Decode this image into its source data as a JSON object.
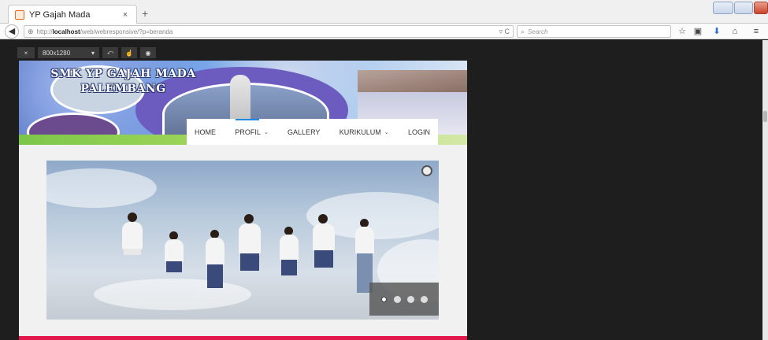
{
  "browser": {
    "tab_title": "YP Gajah Mada",
    "tab_close": "×",
    "new_tab": "+",
    "url_prefix": "http://",
    "url_host": "localhost",
    "url_path": "/web/webresponsive/?p=beranda",
    "search_placeholder": "Search",
    "icons": [
      "back-arrow-icon",
      "globe-icon",
      "reload-icon",
      "search-icon",
      "bookmark-star-icon",
      "clipboard-icon",
      "download-icon",
      "home-icon",
      "menu-icon"
    ]
  },
  "rdm": {
    "close_label": "×",
    "size_label": "800x1280",
    "size_caret": "▾"
  },
  "site": {
    "school_name_line1": "SMK YP GAJAH MADA",
    "school_name_line2": "PALEMBANG",
    "nav": [
      {
        "label": "HOME",
        "has_dropdown": false
      },
      {
        "label": "PROFIL",
        "has_dropdown": true
      },
      {
        "label": "GALLERY",
        "has_dropdown": false
      },
      {
        "label": "KURIKULUM",
        "has_dropdown": true
      },
      {
        "label": "LOGIN",
        "has_dropdown": false
      }
    ],
    "slider": {
      "dot_count": 4,
      "active_dot": 0
    },
    "accent_color": "#e0194a",
    "nav_active_color": "#1e88e5"
  }
}
